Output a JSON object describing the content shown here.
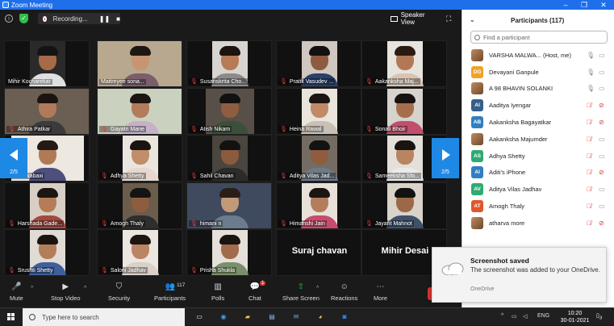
{
  "window": {
    "title": "Zoom Meeting"
  },
  "topbar": {
    "recording_label": "Recording...",
    "pause_glyph": "❚❚",
    "stop_glyph": "■",
    "view_label": "Speaker View"
  },
  "grid": {
    "page_left": "2/5",
    "page_right": "2/5",
    "tiles": [
      {
        "name": "Mihir Kocharekar",
        "muted": false,
        "bg": "#2a2a2a",
        "skin": "#a66a48",
        "hair": "#141414",
        "shirt": "#e0e0e0"
      },
      {
        "name": "Maitreyee sona...",
        "muted": false,
        "bg": "#b8a88f",
        "skin": "#c79572",
        "hair": "#1d1714",
        "shirt": "#7a5f6a"
      },
      {
        "name": "Susanskrita Cho...",
        "muted": true,
        "bg": "#d8d4cf",
        "skin": "#b77b55",
        "hair": "#1b1411",
        "shirt": "#8b8b8b"
      },
      {
        "name": "Pratik Vasudev ...",
        "muted": true,
        "bg": "#cfc7c0",
        "skin": "#8e5b3e",
        "hair": "#111",
        "shirt": "#28406b"
      },
      {
        "name": "Aakanksha Maj...",
        "muted": true,
        "bg": "#e7e3de",
        "skin": "#b27856",
        "hair": "#2a1b12",
        "shirt": "#d9c4b2"
      },
      {
        "name": "Athira Patkar",
        "muted": true,
        "bg": "#6b5e52",
        "skin": "#b07b5b",
        "hair": "#1c1410",
        "shirt": "#3b3b3b"
      },
      {
        "name": "Gayatri Mane",
        "muted": true,
        "bg": "#cbd1bf",
        "skin": "#b27b5a",
        "hair": "#1b1613",
        "shirt": "#c6b2c8"
      },
      {
        "name": "Atish Nikam",
        "muted": true,
        "bg": "#585048",
        "skin": "#8f5d40",
        "hair": "#121212",
        "shirt": "#3c4f39"
      },
      {
        "name": "Heina Rawal",
        "muted": true,
        "bg": "#e9e4dc",
        "skin": "#c08a66",
        "hair": "#1c1511",
        "shirt": "#c9c0b5"
      },
      {
        "name": "Sonali Bhoir",
        "muted": true,
        "bg": "#d6d2cd",
        "skin": "#a56f4e",
        "hair": "#181310",
        "shirt": "#c24f6a"
      },
      {
        "name": "...nikabaxi",
        "muted": true,
        "bg": "#ede8e0",
        "skin": "#b07a57",
        "hair": "#231915",
        "shirt": "#4d4f7d"
      },
      {
        "name": "Adhya Shetty",
        "muted": true,
        "bg": "#eae5de",
        "skin": "#c18e6a",
        "hair": "#1b1511",
        "shirt": "#e6d7cf"
      },
      {
        "name": "Sahil Chavan",
        "muted": true,
        "bg": "#4a463f",
        "skin": "#8b5b3e",
        "hair": "#121212",
        "shirt": "#2b2b2b"
      },
      {
        "name": "Aditya Vilas Jad...",
        "muted": true,
        "bg": "#746c62",
        "skin": "#8e5c3f",
        "hair": "#131313",
        "shirt": "#6e7a86"
      },
      {
        "name": "Sameeksha Shi...",
        "muted": true,
        "bg": "#e4dfd8",
        "skin": "#b98561",
        "hair": "#1a1411",
        "shirt": "#eaeaea"
      },
      {
        "name": "Harshada Gade...",
        "muted": true,
        "bg": "#d7cfc5",
        "skin": "#b57c58",
        "hair": "#1c1612",
        "shirt": "#a4483f"
      },
      {
        "name": "Amogh Thaly",
        "muted": true,
        "bg": "#6b5c4b",
        "skin": "#8e5d40",
        "hair": "#141414",
        "shirt": "#2e2e2e"
      },
      {
        "name": "himani n",
        "muted": true,
        "bg": "#3f4a5e",
        "skin": "#c29a77",
        "hair": "#2a1e17",
        "shirt": "#6a7c8e"
      },
      {
        "name": "Himanshi Jain",
        "muted": true,
        "bg": "#e7e1da",
        "skin": "#b47e5c",
        "hair": "#1c1612",
        "shirt": "#c74b6d"
      },
      {
        "name": "Jayant Mahnot",
        "muted": true,
        "bg": "#d9d3c9",
        "skin": "#9d6848",
        "hair": "#121212",
        "shirt": "#3f506b"
      },
      {
        "name": "Srushti Shetty",
        "muted": true,
        "bg": "#e0dbd4",
        "skin": "#b47d5a",
        "hair": "#1a1411",
        "shirt": "#3d5f9a"
      },
      {
        "name": "Saloni Jadhav",
        "muted": true,
        "bg": "#ebe6df",
        "skin": "#b98562",
        "hair": "#1c1511",
        "shirt": "#d9d0c8"
      },
      {
        "name": "Prisha Shukla",
        "muted": true,
        "bg": "#e5e0d9",
        "skin": "#a06c4b",
        "hair": "#1a1410",
        "shirt": "#7a8f6a"
      },
      {
        "name": "Suraj chavan",
        "muted": false,
        "text_only": true
      },
      {
        "name": "Mihir Desai",
        "muted": false,
        "text_only": true
      }
    ]
  },
  "toolbar": {
    "items": [
      {
        "label": "Mute",
        "icon": "microphone-icon"
      },
      {
        "label": "Stop Video",
        "icon": "video-camera-icon"
      },
      {
        "label": "Security",
        "icon": "shield-icon"
      },
      {
        "label": "Participants",
        "icon": "people-icon",
        "count": "117"
      },
      {
        "label": "Polls",
        "icon": "bar-chart-icon"
      },
      {
        "label": "Chat",
        "icon": "chat-bubble-icon",
        "badge": "1"
      },
      {
        "label": "Share Screen",
        "icon": "share-arrow-icon"
      },
      {
        "label": "Reactions",
        "icon": "smiley-plus-icon"
      },
      {
        "label": "More",
        "icon": "ellipsis-icon"
      }
    ]
  },
  "panel": {
    "title": "Participants (117)",
    "search_placeholder": "Find a participant",
    "participants": [
      {
        "name": "VARSHA MALWA... (Host, me)",
        "avatar": "",
        "color": "",
        "photo": true,
        "mic_muted": false,
        "cam_off": false
      },
      {
        "name": "Devayani Ganpule",
        "avatar": "DG",
        "color": "#f0a229",
        "photo": false,
        "mic_muted": false,
        "cam_off": false
      },
      {
        "name": "A 98 BHAVIN SOLANKI",
        "avatar": "",
        "color": "#555",
        "photo": true,
        "mic_muted": false,
        "cam_off": false
      },
      {
        "name": "Aaditya Iyengar",
        "avatar": "AI",
        "color": "#365f8a",
        "photo": false,
        "mic_muted": true,
        "cam_off": true
      },
      {
        "name": "Aakanksha Bagayatkar",
        "avatar": "AB",
        "color": "#2f7fc1",
        "photo": false,
        "mic_muted": true,
        "cam_off": true
      },
      {
        "name": "Aakanksha Majumder",
        "avatar": "",
        "color": "",
        "photo": true,
        "mic_muted": true,
        "cam_off": false
      },
      {
        "name": "Adhya Shetty",
        "avatar": "AS",
        "color": "#2faa72",
        "photo": false,
        "mic_muted": true,
        "cam_off": false
      },
      {
        "name": "Aditi's iPhone",
        "avatar": "AI",
        "color": "#2f7fc1",
        "photo": false,
        "mic_muted": true,
        "cam_off": true
      },
      {
        "name": "Aditya Vilas Jadhav",
        "avatar": "AV",
        "color": "#2faa72",
        "photo": false,
        "mic_muted": true,
        "cam_off": false
      },
      {
        "name": "Amogh Thaly",
        "avatar": "AT",
        "color": "#e2562c",
        "photo": false,
        "mic_muted": true,
        "cam_off": false
      },
      {
        "name": "atharva more",
        "avatar": "",
        "color": "",
        "photo": true,
        "mic_muted": true,
        "cam_off": true
      }
    ]
  },
  "toast": {
    "title": "Screenshot saved",
    "body": "The screenshot was added to your OneDrive.",
    "source": "OneDrive"
  },
  "taskbar": {
    "search_placeholder": "Type here to search",
    "apps": [
      "task-view-icon",
      "edge-icon",
      "file-explorer-icon",
      "store-icon",
      "mail-icon",
      "chrome-icon",
      "zoom-icon"
    ],
    "lang": "ENG",
    "time": "10:20",
    "date": "30-01-2021",
    "notification_count": "3"
  },
  "colors": {
    "accent": "#1e88e5",
    "titlebar": "#1f6feb",
    "muted_red": "#e23b3b",
    "share_green": "#27c43e"
  }
}
